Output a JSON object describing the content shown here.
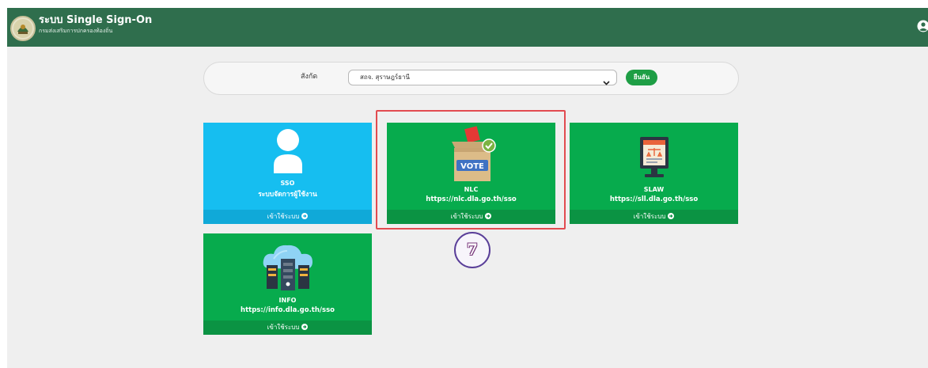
{
  "header": {
    "title": "ระบบ Single Sign-On",
    "subtitle": "กรมส่งเสริมการปกครองท้องถิ่น",
    "bar_color": "#2f6e4d",
    "user_icon": "user-circle-icon"
  },
  "filter": {
    "label": "สังกัด",
    "selected": "สถจ. สุราษฎร์ธานี",
    "confirm_label": "ยืนยัน"
  },
  "cards": [
    {
      "name": "SSO",
      "desc": "ระบบจัดการผู้ใช้งาน",
      "enter_label": "เข้าใช้ระบบ",
      "icon": "user-icon",
      "color": "#16bef0"
    },
    {
      "name": "NLC",
      "desc": "https://nlc.dla.go.th/sso",
      "enter_label": "เข้าใช้ระบบ",
      "icon": "ballot-box-icon",
      "color": "#07ab4d"
    },
    {
      "name": "SLAW",
      "desc": "https://sll.dla.go.th/sso",
      "enter_label": "เข้าใช้ระบบ",
      "icon": "law-document-monitor-icon",
      "color": "#07ab4d"
    },
    {
      "name": "INFO",
      "desc": "https://info.dla.go.th/sso",
      "enter_label": "เข้าใช้ระบบ",
      "icon": "cloud-server-icon",
      "color": "#07ab4d"
    }
  ],
  "annotation": {
    "step": "7",
    "highlight_color": "#e24b50"
  }
}
